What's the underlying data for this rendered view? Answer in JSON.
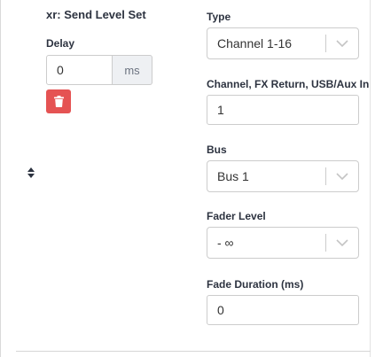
{
  "action": {
    "title": "xr: Send Level Set"
  },
  "delay": {
    "label": "Delay",
    "value": "0",
    "unit": "ms"
  },
  "type_field": {
    "label": "Type",
    "value": "Channel 1-16"
  },
  "channel_field": {
    "label": "Channel, FX Return, USB/Aux In",
    "value": "1"
  },
  "bus_field": {
    "label": "Bus",
    "value": "Bus 1"
  },
  "fader_field": {
    "label": "Fader Level",
    "value": "- ∞"
  },
  "fade_duration_field": {
    "label": "Fade Duration (ms)",
    "value": "0"
  },
  "icons": {
    "drag": "sort-icon",
    "delete": "trash-icon",
    "dropdown": "chevron-down-icon"
  },
  "colors": {
    "delete_button": "#e55353",
    "text": "#2d3340",
    "border": "#cccccc",
    "addon_bg": "#eef0f3"
  }
}
